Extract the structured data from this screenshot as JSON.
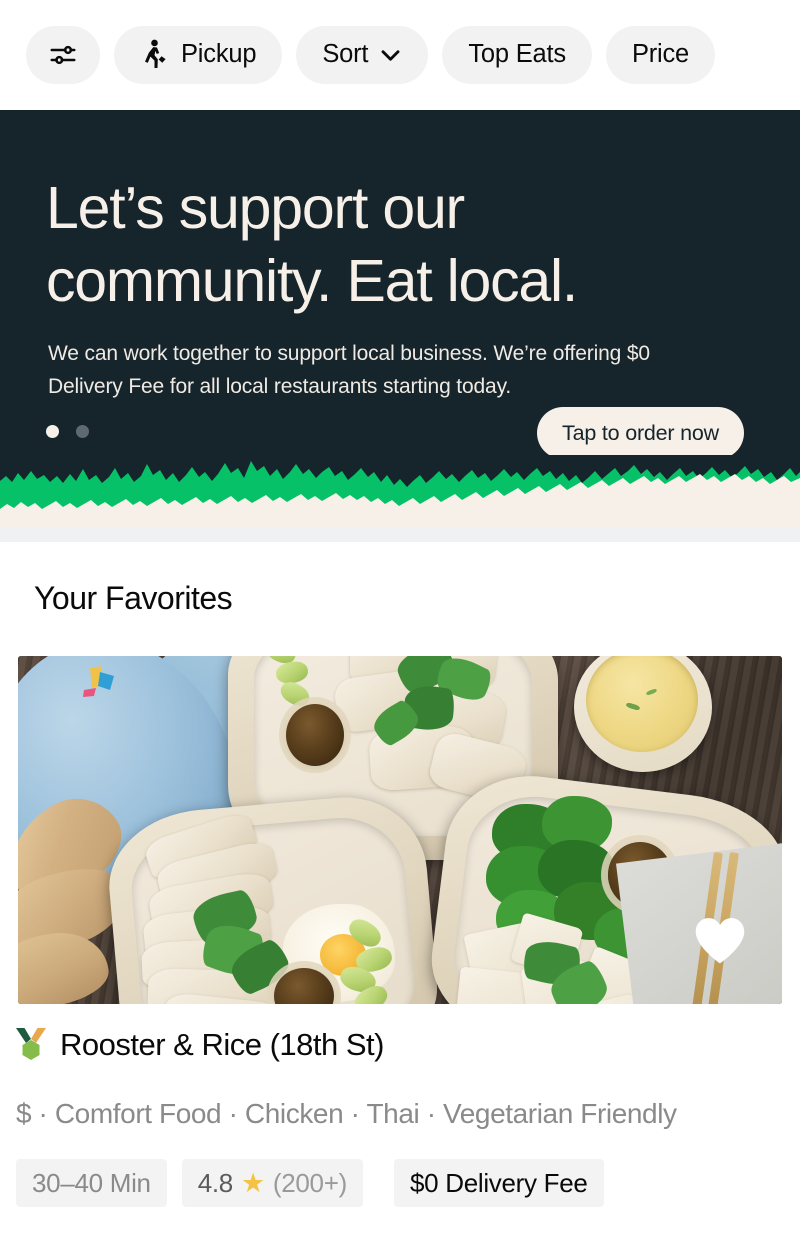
{
  "filter_bar": {
    "chips": [
      {
        "id": "filters",
        "label": "",
        "icon": "sliders-icon"
      },
      {
        "id": "pickup",
        "label": "Pickup",
        "icon": "walking-person-icon"
      },
      {
        "id": "sort",
        "label": "Sort",
        "icon": "chevron-down-icon"
      },
      {
        "id": "top_eats",
        "label": "Top Eats",
        "icon": ""
      },
      {
        "id": "price",
        "label": "Price",
        "icon": ""
      }
    ]
  },
  "hero": {
    "title": "Let’s support our community. Eat local.",
    "subtitle": "We can work together to support local business. We’re offering $0 Delivery Fee for all local restaurants starting today.",
    "cta_label": "Tap to order now",
    "dots": {
      "count": 2,
      "active_index": 0
    },
    "colors": {
      "background": "#16242b",
      "text": "#f6f0e8",
      "torn_green": "#06c167",
      "torn_cream": "#f6f0e8"
    }
  },
  "favorites": {
    "section_title": "Your Favorites",
    "restaurant": {
      "name": "Rooster & Rice (18th St)",
      "badge_icon": "medal-icon",
      "favorited": true,
      "favorite_icon": "heart-filled-icon",
      "price_level": "$",
      "tags_line": "$ · Comfort Food · Chicken · Thai · Vegetarian Friendly",
      "cuisines": [
        "Comfort Food",
        "Chicken",
        "Thai",
        "Vegetarian Friendly"
      ],
      "delivery_time": "30–40 Min",
      "rating_value": "4.8",
      "rating_count": "(200+)",
      "rating_icon": "star-icon",
      "delivery_fee": "$0 Delivery Fee"
    }
  }
}
